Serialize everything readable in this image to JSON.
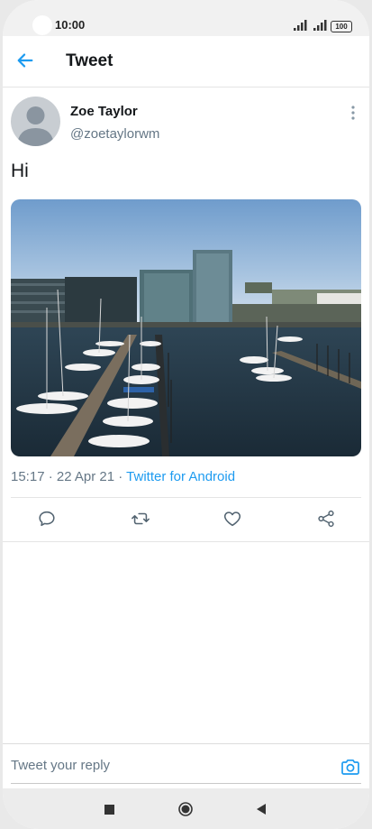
{
  "status": {
    "time": "10:00",
    "battery": "100"
  },
  "header": {
    "title": "Tweet"
  },
  "tweet": {
    "name": "Zoe Taylor",
    "handle": "@zoetaylorwm",
    "text": "Hi",
    "time": "15:17 · 22 Apr 21 · ",
    "source": "Twitter for Android"
  },
  "reply": {
    "placeholder": "Tweet your reply"
  },
  "icons": {
    "back": "arrow-left-icon",
    "more": "more-vertical-icon",
    "reply": "comment-icon",
    "retweet": "retweet-icon",
    "like": "heart-icon",
    "share": "share-icon",
    "camera": "camera-icon"
  },
  "colors": {
    "accent": "#1d9bf0",
    "text": "#14171a",
    "muted": "#657786"
  }
}
